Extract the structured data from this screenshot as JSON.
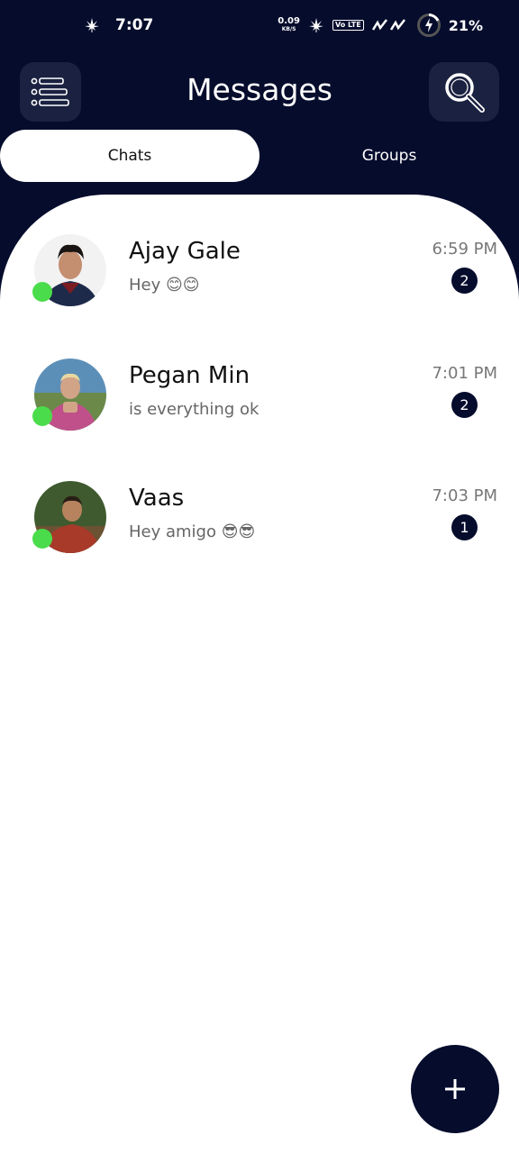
{
  "status_bar": {
    "time": "7:07",
    "net_speed": "0.09",
    "net_speed_unit": "KB/S",
    "volte": "Vo LTE",
    "battery": "21%",
    "icons": [
      "cannabis-leaf-icon",
      "signal-icon",
      "battery-charging-icon"
    ]
  },
  "header": {
    "title": "Messages",
    "menu_icon": "list-menu-icon",
    "search_icon": "magnifier-icon"
  },
  "tabs": [
    {
      "label": "Chats",
      "active": true
    },
    {
      "label": "Groups",
      "active": false
    }
  ],
  "chats": [
    {
      "name": "Ajay Gale",
      "message": "Hey 😊😊",
      "time": "6:59 PM",
      "unread": "2",
      "online": true
    },
    {
      "name": "Pegan Min",
      "message": "is everything ok",
      "time": "7:01 PM",
      "unread": "2",
      "online": true
    },
    {
      "name": "Vaas",
      "message": "Hey amigo 😎😎",
      "time": "7:03 PM",
      "unread": "1",
      "online": true
    }
  ],
  "fab": {
    "icon": "plus-icon"
  },
  "colors": {
    "primary": "#050c2c",
    "online": "#4bdc4b",
    "surface": "#ffffff"
  }
}
